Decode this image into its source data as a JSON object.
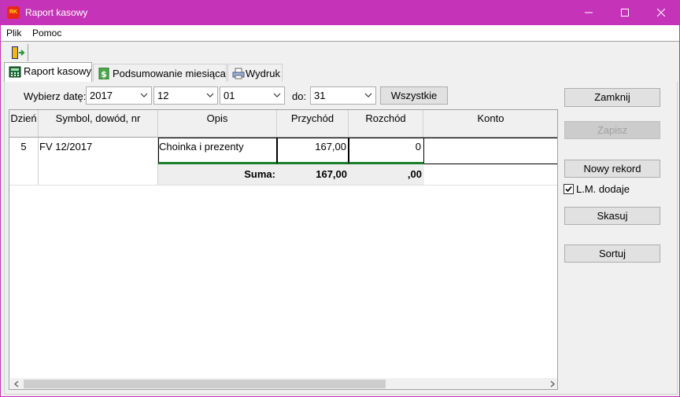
{
  "window": {
    "title": "Raport kasowy",
    "app_icon_text": "RK",
    "accent": "#c534b8"
  },
  "menu": {
    "file": "Plik",
    "help": "Pomoc"
  },
  "tabs": [
    {
      "label": "Raport kasowy",
      "icon": "calculator-icon"
    },
    {
      "label": "Podsumowanie miesiąca",
      "icon": "dollar-icon"
    },
    {
      "label": "Wydruk",
      "icon": "printer-icon"
    }
  ],
  "filter": {
    "date_label": "Wybierz datę:",
    "year": "2017",
    "month": "12",
    "day_from": "01",
    "to_label": "do:",
    "day_to": "31",
    "all_button": "Wszystkie"
  },
  "buttons": {
    "close": "Zamknij",
    "save": "Zapisz",
    "new_record": "Nowy rekord",
    "lm_adds": "L.M. dodaje",
    "delete": "Skasuj",
    "sort": "Sortuj"
  },
  "table": {
    "columns": [
      "Dzień",
      "Symbol, dowód, nr",
      "Opis",
      "Przychód",
      "Rozchód",
      "Konto"
    ],
    "rows": [
      {
        "day": "5",
        "symbol": "FV 12/2017",
        "description": "Choinka i prezenty",
        "income": "167,00",
        "expense": "0",
        "account": ""
      }
    ],
    "summary": {
      "label": "Suma:",
      "income": "167,00",
      "expense": ",00"
    }
  }
}
